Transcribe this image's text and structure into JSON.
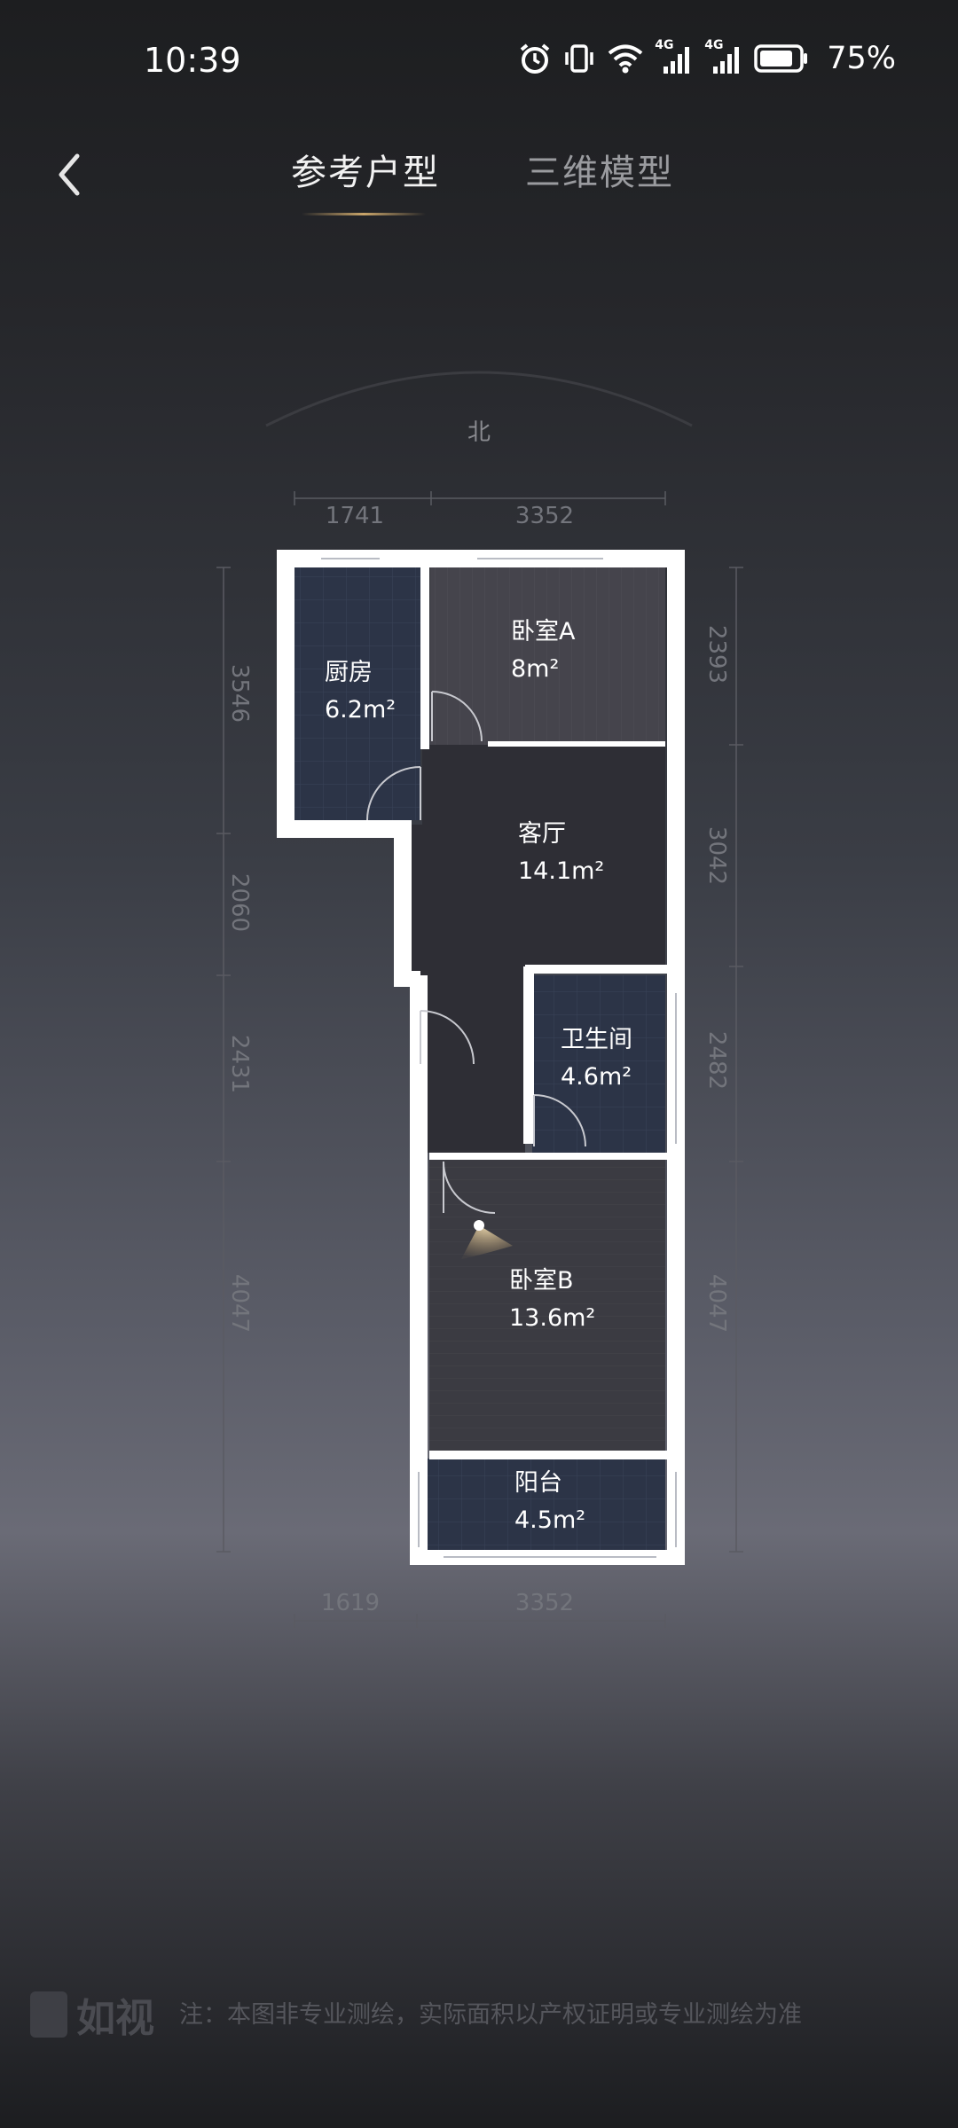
{
  "status_bar": {
    "time": "10:39",
    "signal1": "4G",
    "signal2": "4G",
    "battery": "75%",
    "icons": [
      "alarm-icon",
      "vibrate-icon",
      "wifi-icon",
      "signal-icon",
      "battery-icon"
    ]
  },
  "nav": {
    "back_icon": "chevron-left-icon",
    "tabs": [
      {
        "label": "参考户型",
        "active": true
      },
      {
        "label": "三维模型",
        "active": false
      }
    ]
  },
  "compass": {
    "label": "北"
  },
  "dimensions": {
    "top": [
      "1741",
      "3352"
    ],
    "bottom": [
      "1619",
      "3352"
    ],
    "left": [
      "3546",
      "2060",
      "2431",
      "4047"
    ],
    "right": [
      "2393",
      "3042",
      "2482",
      "4047"
    ]
  },
  "rooms": [
    {
      "name": "厨房",
      "area": "6.2m²"
    },
    {
      "name": "卧室A",
      "area": "8m²"
    },
    {
      "name": "客厅",
      "area": "14.1m²"
    },
    {
      "name": "卫生间",
      "area": "4.6m²"
    },
    {
      "name": "卧室B",
      "area": "13.6m²"
    },
    {
      "name": "阳台",
      "area": "4.5m²"
    }
  ],
  "footer": {
    "logo": "如视",
    "note": "注：本图非专业测绘，实际面积以产权证明或专业测绘为准"
  },
  "colors": {
    "accent": "#c9a56a",
    "wall": "#ffffff",
    "room_blue": "#2c3447",
    "room_dark": "#34343b"
  }
}
